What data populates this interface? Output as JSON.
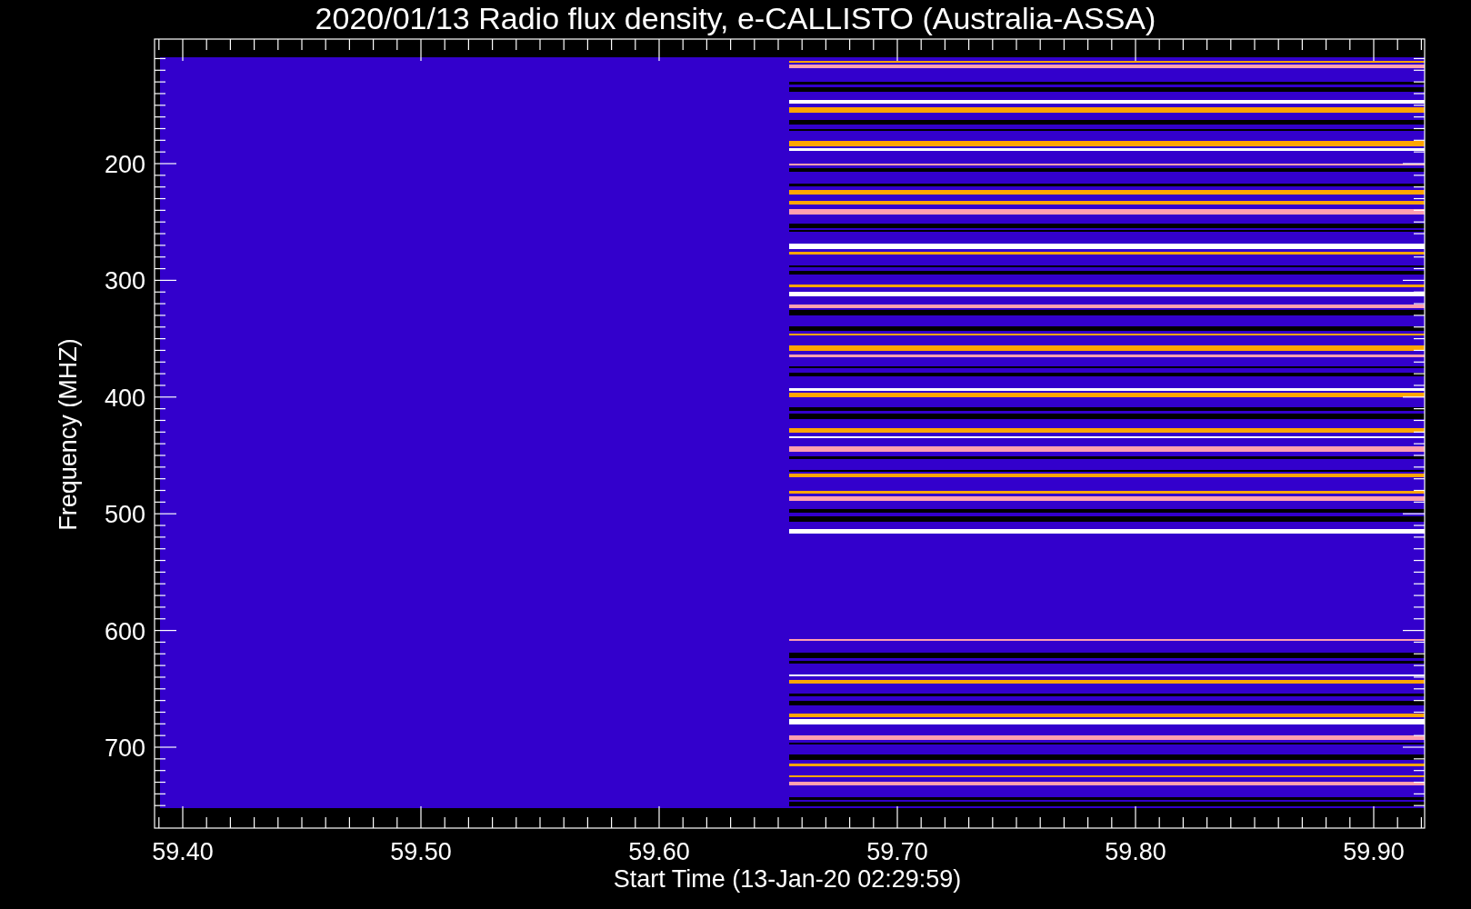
{
  "plot": {
    "title": "2020/01/13  Radio flux density, e-CALLISTO (Australia-ASSA)",
    "x_axis": {
      "label": "Start Time (13-Jan-20 02:29:59)",
      "ticks": [
        "59.40",
        "59.50",
        "59.60",
        "59.70",
        "59.80",
        "59.90"
      ]
    },
    "y_axis": {
      "label": "Frequency (MHZ)",
      "ticks": [
        "200",
        "300",
        "400",
        "500",
        "600",
        "700"
      ]
    }
  }
}
